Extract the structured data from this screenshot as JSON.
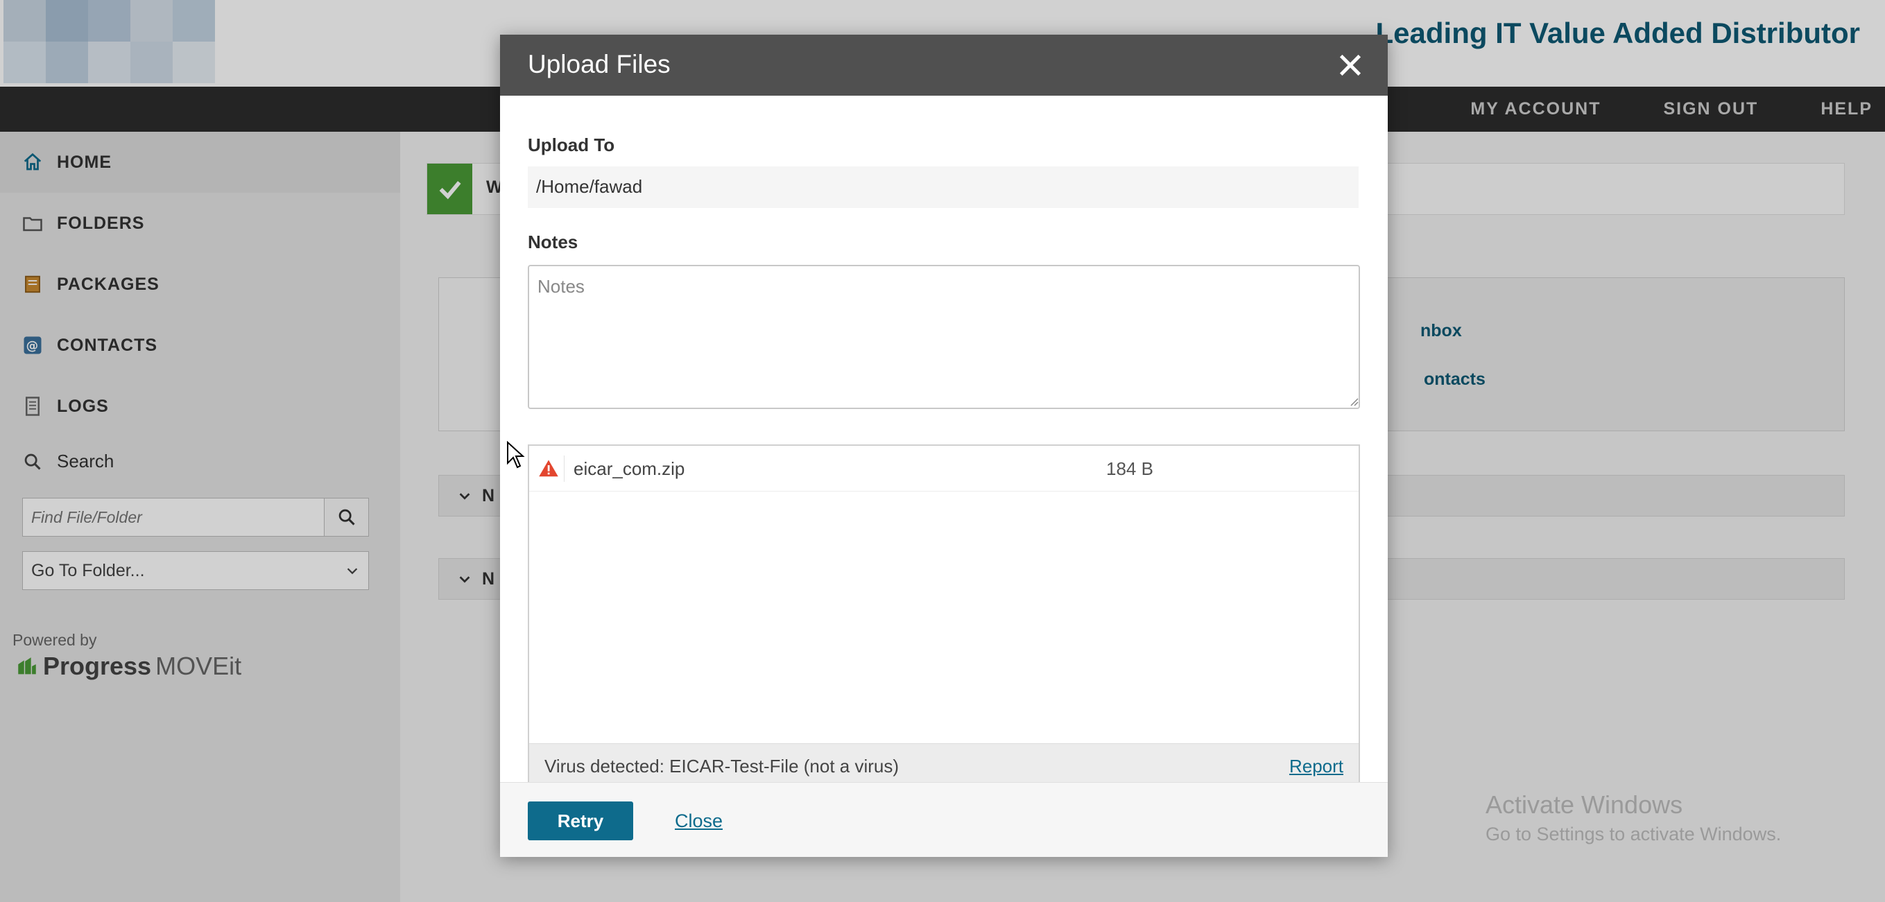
{
  "brand": {
    "tagline": "Leading IT Value Added Distributor"
  },
  "nav": {
    "links": [
      "MY ACCOUNT",
      "SIGN OUT",
      "HELP"
    ]
  },
  "sidebar": {
    "items": [
      {
        "label": "HOME",
        "icon": "home-icon"
      },
      {
        "label": "FOLDERS",
        "icon": "folder-icon"
      },
      {
        "label": "PACKAGES",
        "icon": "package-icon"
      },
      {
        "label": "CONTACTS",
        "icon": "at-icon"
      },
      {
        "label": "LOGS",
        "icon": "log-icon"
      }
    ],
    "search_label": "Search",
    "search_placeholder": "Find File/Folder",
    "goto_folder": "Go To Folder...",
    "powered_by": "Powered by",
    "progress_brand": "Progress",
    "moveit_brand": "MOVEit"
  },
  "content": {
    "welcome_fragment": "W",
    "panel_links": [
      "nbox",
      "ontacts"
    ],
    "section_fragments": [
      "N",
      "N"
    ]
  },
  "modal": {
    "title": "Upload Files",
    "upload_to_label": "Upload To",
    "upload_to_value": "/Home/fawad",
    "notes_label": "Notes",
    "notes_placeholder": "Notes",
    "files": [
      {
        "name": "eicar_com.zip",
        "size": "184 B"
      }
    ],
    "status_message": "Virus detected: EICAR-Test-File (not a virus)",
    "report_label": "Report",
    "retry_label": "Retry",
    "close_label": "Close"
  },
  "watermark": {
    "title": "Activate Windows",
    "subtitle": "Go to Settings to activate Windows."
  },
  "colors": {
    "accent": "#0e6b8c",
    "brand": "#0e5a74",
    "success": "#4a9a36",
    "warning": "#e3462f",
    "header": "#505050",
    "navbar": "#2d2d2d"
  }
}
